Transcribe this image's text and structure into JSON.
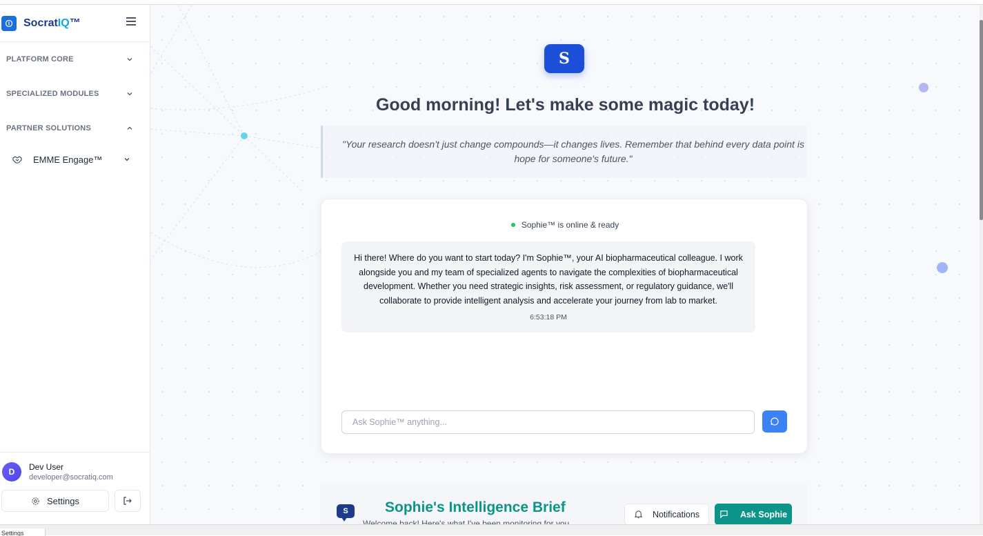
{
  "app": {
    "brand_prefix": "Socrat",
    "brand_accent": "IQ",
    "brand_suffix": "™",
    "brand_color": "#1e3a8a",
    "accent_color": "#0ea5e9"
  },
  "sidebar": {
    "sections": [
      {
        "label": "PLATFORM CORE",
        "expanded": false
      },
      {
        "label": "SPECIALIZED MODULES",
        "expanded": false
      },
      {
        "label": "PARTNER SOLUTIONS",
        "expanded": true
      }
    ],
    "sub_items": [
      {
        "label": "EMME Engage™",
        "icon": "handshake-icon"
      }
    ],
    "user": {
      "initial": "D",
      "name": "Dev User",
      "email": "developer@socratiq.com"
    },
    "settings_label": "Settings"
  },
  "main": {
    "hero_letter": "S",
    "greeting": "Good morning! Let's make some magic today!",
    "quote": "\"Your research doesn't just change compounds—it changes lives. Remember that behind every data point is hope for someone's future.\""
  },
  "chat": {
    "status": "Sophie™ is online & ready",
    "status_color": "#22c55e",
    "message": "Hi there! Where do you want to start today? I'm Sophie™, your AI biopharmaceutical colleague. I work alongside you and my team of specialized agents to navigate the complexities of biopharmaceutical development. Whether you need strategic insights, risk assessment, or regulatory guidance, we'll collaborate to provide intelligent analysis and accelerate your journey from lab to market.",
    "timestamp": "6:53:18 PM",
    "input_placeholder": "Ask Sophie™ anything...",
    "send_color": "#3b82f6"
  },
  "brief": {
    "icon_letter": "S",
    "title": "Sophie's Intelligence Brief",
    "subtitle": "Welcome back! Here's what I've been monitoring for you",
    "notifications_label": "Notifications",
    "ask_label": "Ask Sophie",
    "accent_color": "#0d9488"
  },
  "taskbar": {
    "tab_label": "Settings"
  }
}
